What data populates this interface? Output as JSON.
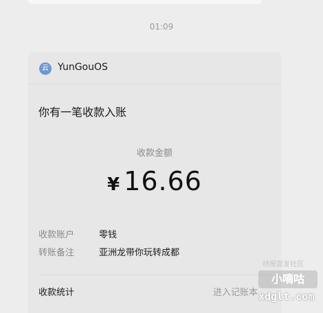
{
  "timestamp": "01:09",
  "card": {
    "app_icon_glyph": "云",
    "app_name": "YunGouOS",
    "notice_title": "你有一笔收款入账",
    "amount_label": "收款金额",
    "currency_symbol": "¥",
    "amount": "16.66",
    "details": [
      {
        "label": "收款账户",
        "value": "零钱"
      },
      {
        "label": "转账备注",
        "value": "亚洲龙带你玩转成都"
      }
    ],
    "footer_left": "收款统计",
    "footer_right": "进入记账本"
  },
  "watermark": {
    "small_text": "线报首发社区",
    "box_text": "小嘀咕",
    "url_text": "xdglt.com"
  }
}
